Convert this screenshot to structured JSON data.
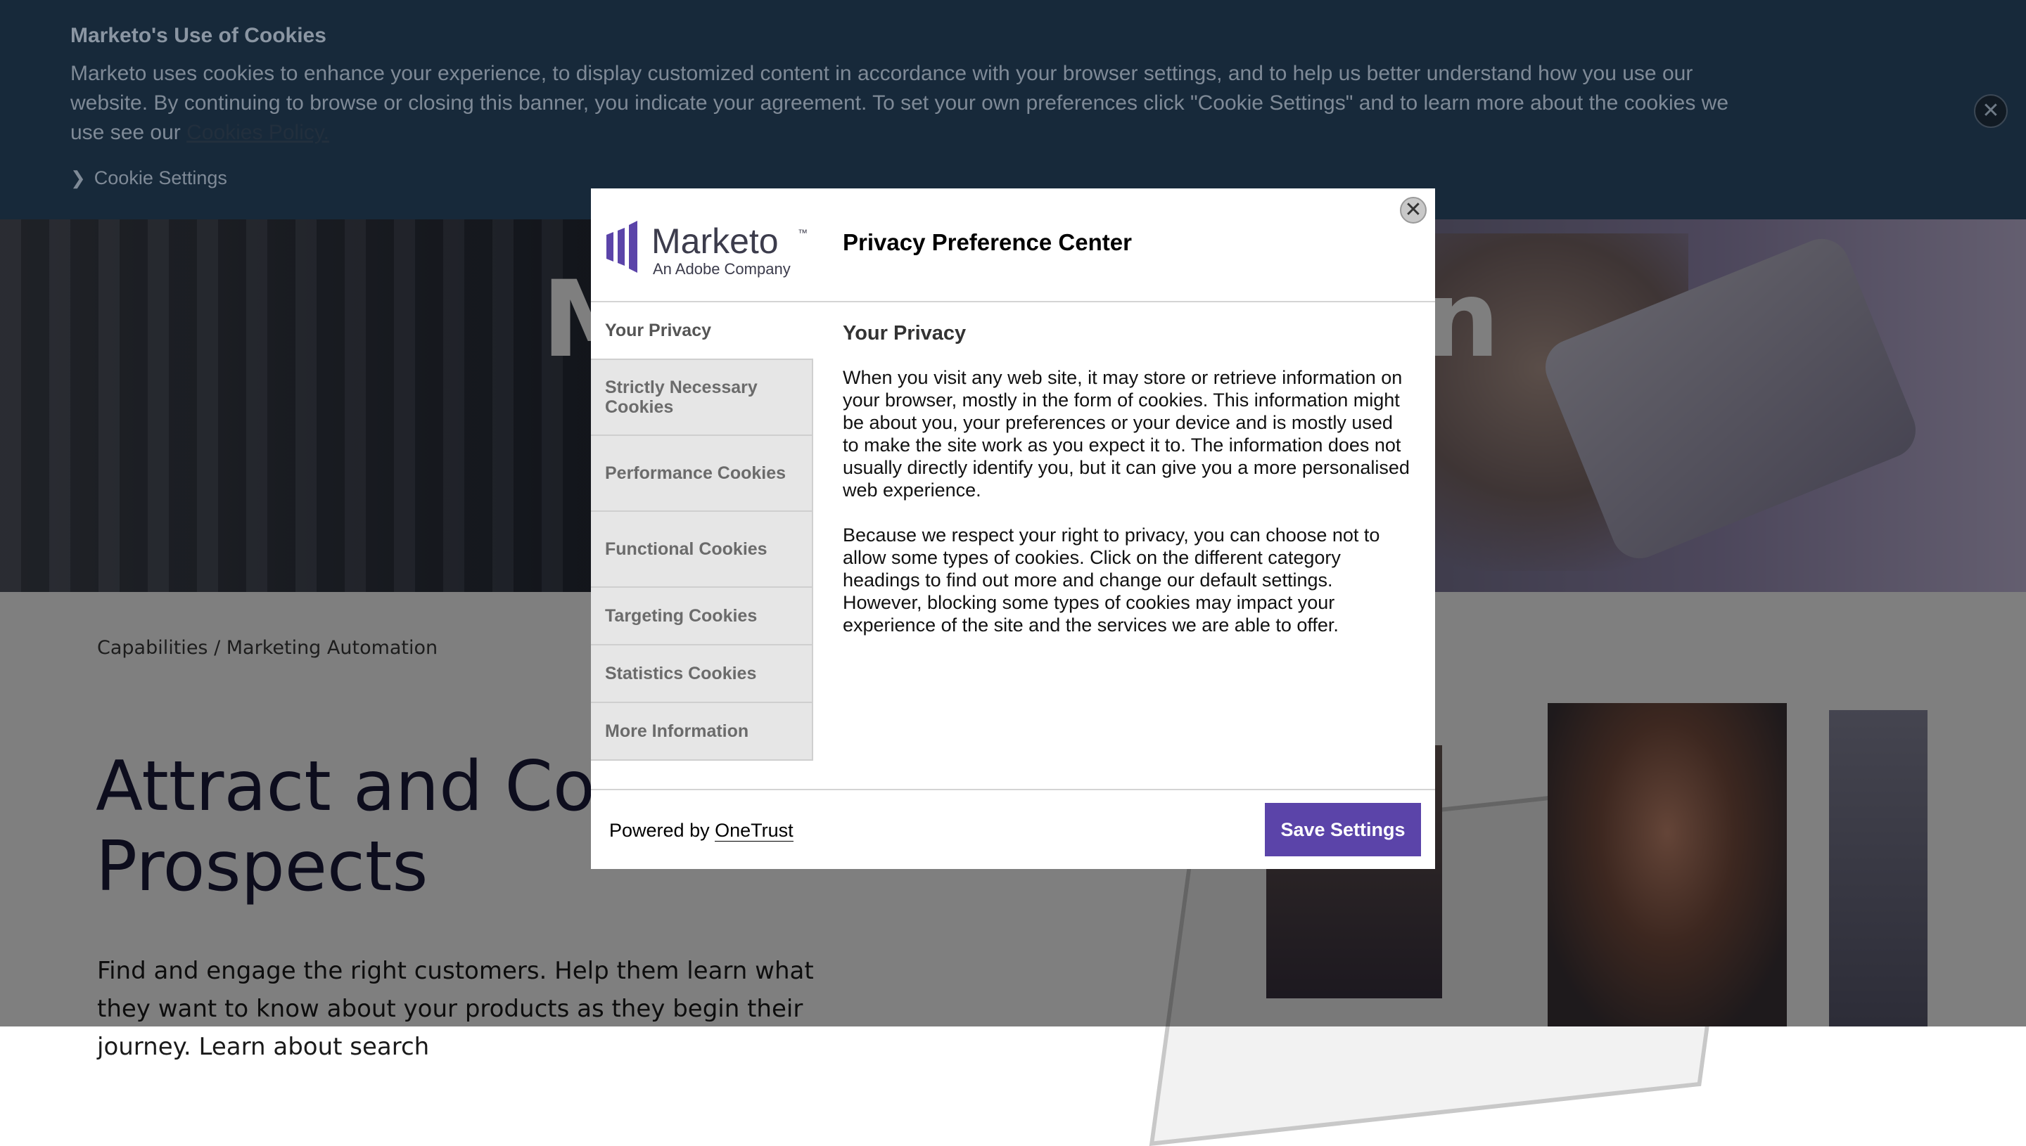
{
  "cookie_banner": {
    "title": "Marketo's Use of Cookies",
    "text": "Marketo uses cookies to enhance your experience, to display customized content in accordance with your browser settings, and to help us better understand how you use our website. By continuing to browse or closing this banner, you indicate your agreement. To set your own preferences click \"Cookie Settings\" and to learn more about the cookies we use see our ",
    "policy_link": "Cookies Policy.",
    "settings_label": "Cookie Settings",
    "close_label": "✕"
  },
  "page": {
    "hero_title_left": "M",
    "hero_title_right": "n",
    "breadcrumb": "Capabilities / Marketing Automation",
    "heading_line1": "Attract and Conve",
    "heading_line2": "Prospects",
    "body": "Find and engage the right customers. Help them learn what they want to know about your products as they begin their journey. Learn about search"
  },
  "modal": {
    "logo": {
      "brand": "Marketo",
      "trademark": "™",
      "tagline": "An Adobe Company",
      "accent_color": "#5b44a9"
    },
    "title": "Privacy Preference Center",
    "close_label": "✕",
    "nav": [
      {
        "label": "Your Privacy"
      },
      {
        "label": "Strictly Necessary Cookies"
      },
      {
        "label": "Performance Cookies"
      },
      {
        "label": "Functional Cookies"
      },
      {
        "label": "Targeting Cookies"
      },
      {
        "label": "Statistics Cookies"
      },
      {
        "label": "More Information"
      }
    ],
    "content": {
      "title": "Your Privacy",
      "paragraphs": [
        "When you visit any web site, it may store or retrieve information on your browser, mostly in the form of cookies. This information might be about you, your preferences or your device and is mostly used to make the site work as you expect it to. The information does not usually directly identify you, but it can give you a more personalised web experience.",
        "Because we respect your right to privacy, you can choose not to allow some types of cookies. Click on the different category headings to find out more and change our default settings. However, blocking some types of cookies may impact your experience of the site and the services we are able to offer."
      ]
    },
    "footer": {
      "powered_by": "Powered by ",
      "provider": "OneTrust",
      "save_label": "Save Settings"
    }
  }
}
